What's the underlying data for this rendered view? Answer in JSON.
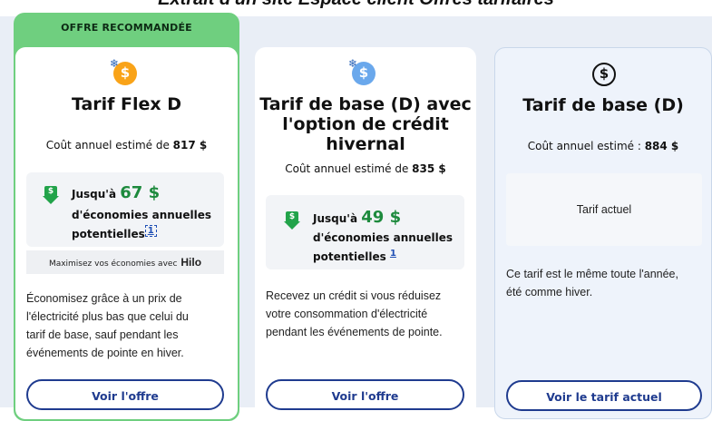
{
  "page_title": "Extrait d'un site Espace client Offres tarifaires",
  "cards": [
    {
      "badge": "OFFRE RECOMMANDÉE",
      "icon": "snowflake-dollar-coin-icon",
      "title": "Tarif Flex D",
      "cost_prefix": "Coût annuel estimé de",
      "cost_value": "817 $",
      "savings_prefix": "Jusqu'à",
      "savings_amount": "67 $",
      "savings_line2": "d'économies annuelles",
      "savings_line3": "potentielles",
      "footnote": "1",
      "hilo_text": "Maximisez vos économies avec",
      "hilo_brand": "Hilo",
      "desc_lines": [
        "Économisez grâce à un prix de",
        "l'électricité plus bas que celui du",
        "tarif de base, sauf pendant les",
        "événements de pointe en hiver."
      ],
      "button": "Voir l'offre"
    },
    {
      "icon": "snowflake-dollar-coin-icon",
      "title_lines": [
        "Tarif de base (D) avec",
        "l'option de crédit",
        "hivernal"
      ],
      "cost_prefix": "Coût annuel estimé de",
      "cost_value": "835 $",
      "savings_prefix": "Jusqu'à",
      "savings_amount": "49 $",
      "savings_line2": "d'économies annuelles",
      "savings_line3": "potentielles",
      "footnote": "1",
      "desc_lines": [
        "Recevez un crédit si vous réduisez",
        "votre consommation d'électricité",
        "pendant les événements de pointe."
      ],
      "button": "Voir l'offre"
    },
    {
      "icon": "dollar-circle-icon",
      "title": "Tarif de base (D)",
      "cost_prefix": "Coût annuel estimé :",
      "cost_value": "884 $",
      "current_label": "Tarif actuel",
      "desc_lines": [
        "Ce tarif est le même toute l'année,",
        "été comme hiver."
      ],
      "button": "Voir le tarif actuel"
    }
  ],
  "colors": {
    "green_accent": "#6fcf7f",
    "savings_green": "#1d8a3d",
    "button_blue": "#1f3b8f"
  }
}
